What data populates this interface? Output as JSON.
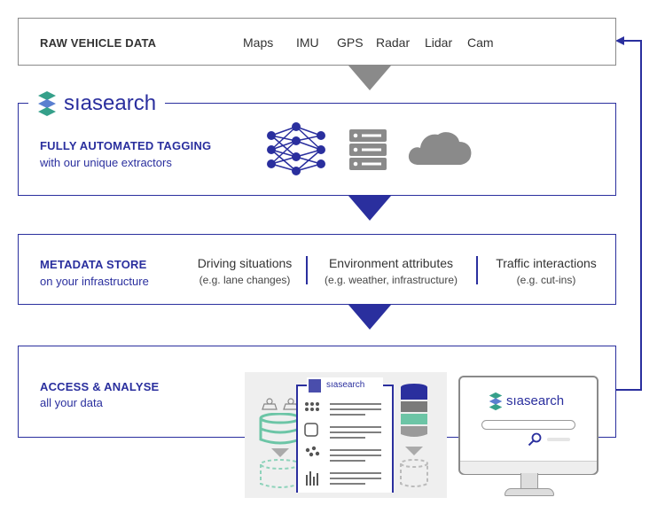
{
  "raw": {
    "title": "RAW VEHICLE DATA",
    "sources": [
      "Maps",
      "IMU",
      "GPS",
      "Radar",
      "Lidar",
      "Cam"
    ]
  },
  "logo": {
    "prefix": "sıa",
    "suffix": "search"
  },
  "tagging": {
    "title": "FULLY AUTOMATED TAGGING",
    "subtitle": "with our unique extractors",
    "icons": [
      "neural-network-icon",
      "server-icon",
      "cloud-icon"
    ]
  },
  "metadata": {
    "title": "METADATA STORE",
    "subtitle": "on your infrastructure",
    "columns": [
      {
        "label": "Driving situations",
        "example": "(e.g. lane changes)"
      },
      {
        "label": "Environment attributes",
        "example": "(e.g. weather, infrastructure)"
      },
      {
        "label": "Traffic interactions",
        "example": "(e.g. cut-ins)"
      }
    ]
  },
  "access": {
    "title": "ACCESS & ANALYSE",
    "subtitle": "all your data"
  },
  "colors": {
    "navy": "#2a2f9e",
    "gray": "#8a8a8a",
    "teal": "#6cc5a6",
    "logo_teal": "#35a08a"
  }
}
